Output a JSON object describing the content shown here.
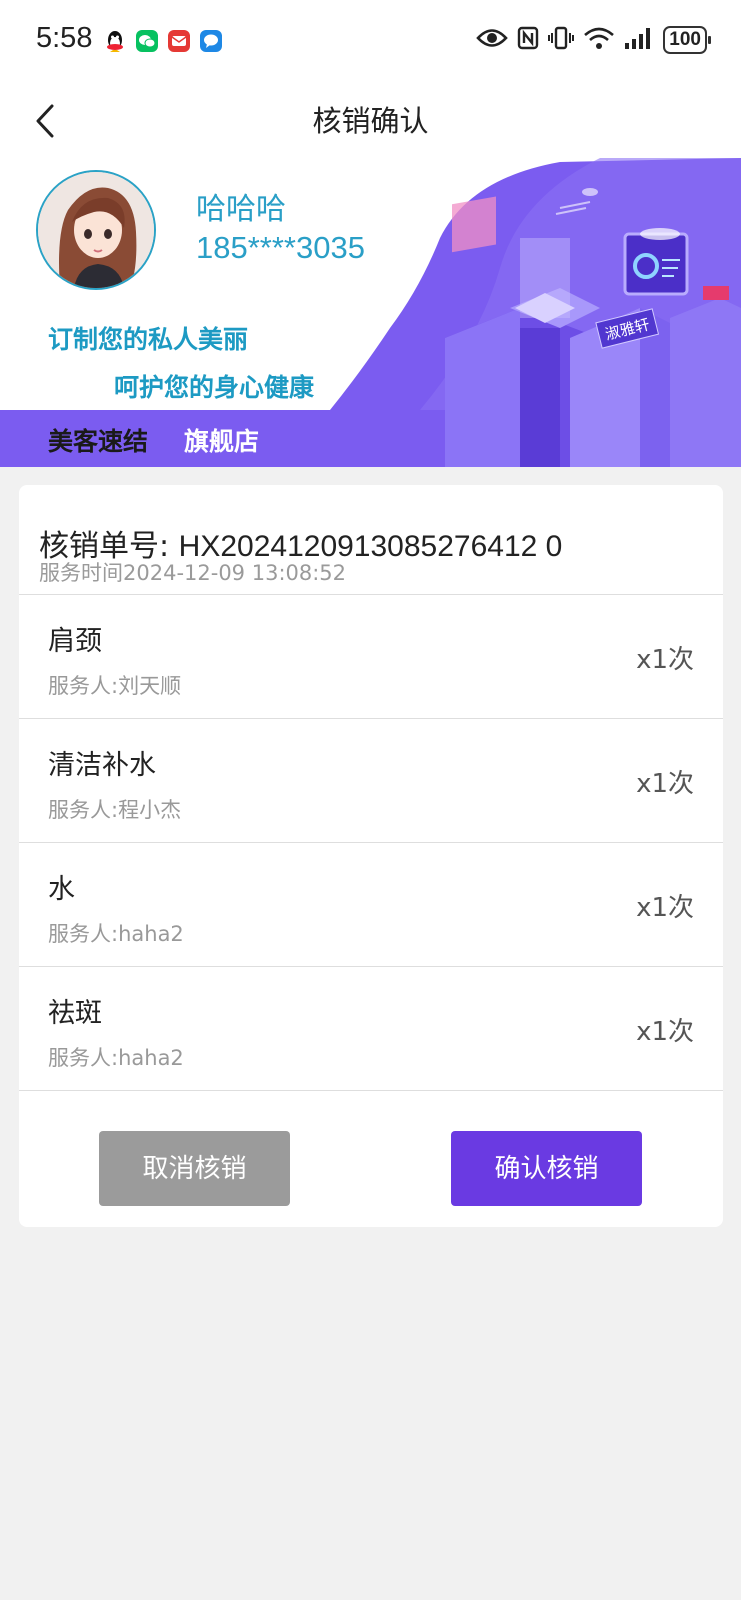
{
  "status_bar": {
    "time": "5:58",
    "notification_icons": [
      "qq-icon",
      "wechat-icon",
      "mail-icon",
      "message-icon"
    ],
    "system_icons": [
      "eye-icon",
      "nfc-icon",
      "vibrate-icon",
      "wifi-icon",
      "signal-icon"
    ],
    "battery": "100"
  },
  "header": {
    "title": "核销确认",
    "back_icon": "chevron-left-icon"
  },
  "banner": {
    "user_name": "哈哈哈",
    "phone": "185****3035",
    "slogan_line1": "订制您的私人美丽",
    "slogan_line2": "呵护您的身心健康",
    "brand_name": "美客速结",
    "store_type": "旗舰店",
    "sign_text": "淑雅轩",
    "colors": {
      "purple": "#7b5cf0",
      "cyan": "#2a9fc7"
    }
  },
  "order": {
    "order_label": "核销单号:",
    "order_no": "HX2024120913085276412 0",
    "service_time_label": "服务时间",
    "service_time": "2024-12-09 13:08:52"
  },
  "items": [
    {
      "name": "肩颈",
      "staff_label": "服务人:",
      "staff": "刘天顺",
      "count": "x1次"
    },
    {
      "name": "清洁补水",
      "staff_label": "服务人:",
      "staff": "程小杰",
      "count": "x1次"
    },
    {
      "name": "水",
      "staff_label": "服务人:",
      "staff": "haha2",
      "count": "x1次"
    },
    {
      "name": "祛斑",
      "staff_label": "服务人:",
      "staff": "haha2",
      "count": "x1次"
    }
  ],
  "actions": {
    "cancel_label": "取消核销",
    "confirm_label": "确认核销",
    "confirm_color": "#6a3ae2",
    "cancel_color": "#9b9b9b"
  }
}
